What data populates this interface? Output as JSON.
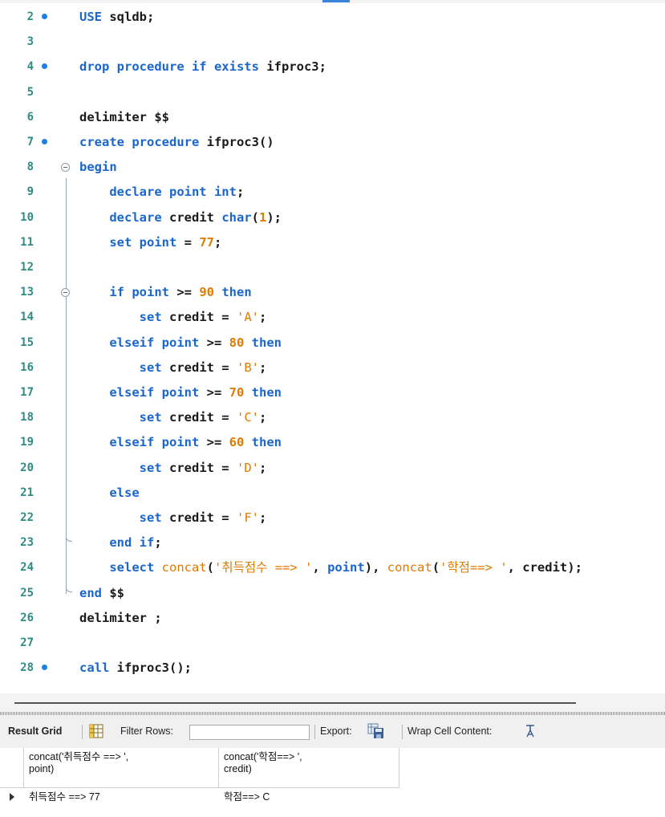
{
  "editor": {
    "lines": [
      {
        "n": "2",
        "bp": true,
        "tokens": [
          [
            "kw",
            "USE"
          ],
          [
            "plain",
            " sqldb;"
          ]
        ]
      },
      {
        "n": "3",
        "bp": false,
        "tokens": []
      },
      {
        "n": "4",
        "bp": true,
        "tokens": [
          [
            "kw",
            "drop procedure if exists"
          ],
          [
            "plain",
            " ifproc3;"
          ]
        ]
      },
      {
        "n": "5",
        "bp": false,
        "tokens": []
      },
      {
        "n": "6",
        "bp": false,
        "tokens": [
          [
            "plain",
            "delimiter $$"
          ]
        ]
      },
      {
        "n": "7",
        "bp": true,
        "tokens": [
          [
            "kw",
            "create procedure"
          ],
          [
            "plain",
            " ifproc3()"
          ]
        ]
      },
      {
        "n": "8",
        "bp": false,
        "tokens": [
          [
            "kw",
            "begin"
          ]
        ]
      },
      {
        "n": "9",
        "bp": false,
        "tokens": [
          [
            "plain",
            "    "
          ],
          [
            "kw",
            "declare point int"
          ],
          [
            "plain",
            ";"
          ]
        ]
      },
      {
        "n": "10",
        "bp": false,
        "tokens": [
          [
            "plain",
            "    "
          ],
          [
            "kw",
            "declare"
          ],
          [
            "plain",
            " credit "
          ],
          [
            "kw",
            "char"
          ],
          [
            "plain",
            "("
          ],
          [
            "num",
            "1"
          ],
          [
            "plain",
            ");"
          ]
        ]
      },
      {
        "n": "11",
        "bp": false,
        "tokens": [
          [
            "plain",
            "    "
          ],
          [
            "kw",
            "set point"
          ],
          [
            "plain",
            " = "
          ],
          [
            "num",
            "77"
          ],
          [
            "plain",
            ";"
          ]
        ]
      },
      {
        "n": "12",
        "bp": false,
        "tokens": []
      },
      {
        "n": "13",
        "bp": false,
        "tokens": [
          [
            "plain",
            "    "
          ],
          [
            "kw",
            "if point"
          ],
          [
            "plain",
            " >= "
          ],
          [
            "num",
            "90"
          ],
          [
            "plain",
            " "
          ],
          [
            "kw",
            "then"
          ]
        ]
      },
      {
        "n": "14",
        "bp": false,
        "tokens": [
          [
            "plain",
            "        "
          ],
          [
            "kw",
            "set"
          ],
          [
            "plain",
            " credit = "
          ],
          [
            "str",
            "'A'"
          ],
          [
            "plain",
            ";"
          ]
        ]
      },
      {
        "n": "15",
        "bp": false,
        "tokens": [
          [
            "plain",
            "    "
          ],
          [
            "kw",
            "elseif point"
          ],
          [
            "plain",
            " >= "
          ],
          [
            "num",
            "80"
          ],
          [
            "plain",
            " "
          ],
          [
            "kw",
            "then"
          ]
        ]
      },
      {
        "n": "16",
        "bp": false,
        "tokens": [
          [
            "plain",
            "        "
          ],
          [
            "kw",
            "set"
          ],
          [
            "plain",
            " credit = "
          ],
          [
            "str",
            "'B'"
          ],
          [
            "plain",
            ";"
          ]
        ]
      },
      {
        "n": "17",
        "bp": false,
        "tokens": [
          [
            "plain",
            "    "
          ],
          [
            "kw",
            "elseif point"
          ],
          [
            "plain",
            " >= "
          ],
          [
            "num",
            "70"
          ],
          [
            "plain",
            " "
          ],
          [
            "kw",
            "then"
          ]
        ]
      },
      {
        "n": "18",
        "bp": false,
        "tokens": [
          [
            "plain",
            "        "
          ],
          [
            "kw",
            "set"
          ],
          [
            "plain",
            " credit = "
          ],
          [
            "str",
            "'C'"
          ],
          [
            "plain",
            ";"
          ]
        ]
      },
      {
        "n": "19",
        "bp": false,
        "tokens": [
          [
            "plain",
            "    "
          ],
          [
            "kw",
            "elseif point"
          ],
          [
            "plain",
            " >= "
          ],
          [
            "num",
            "60"
          ],
          [
            "plain",
            " "
          ],
          [
            "kw",
            "then"
          ]
        ]
      },
      {
        "n": "20",
        "bp": false,
        "tokens": [
          [
            "plain",
            "        "
          ],
          [
            "kw",
            "set"
          ],
          [
            "plain",
            " credit = "
          ],
          [
            "str",
            "'D'"
          ],
          [
            "plain",
            ";"
          ]
        ]
      },
      {
        "n": "21",
        "bp": false,
        "tokens": [
          [
            "plain",
            "    "
          ],
          [
            "kw",
            "else"
          ]
        ]
      },
      {
        "n": "22",
        "bp": false,
        "tokens": [
          [
            "plain",
            "        "
          ],
          [
            "kw",
            "set"
          ],
          [
            "plain",
            " credit = "
          ],
          [
            "str",
            "'F'"
          ],
          [
            "plain",
            ";"
          ]
        ]
      },
      {
        "n": "23",
        "bp": false,
        "tokens": [
          [
            "plain",
            "    "
          ],
          [
            "kw",
            "end if"
          ],
          [
            "plain",
            ";"
          ]
        ]
      },
      {
        "n": "24",
        "bp": false,
        "tokens": [
          [
            "plain",
            "    "
          ],
          [
            "kw",
            "select"
          ],
          [
            "plain",
            " "
          ],
          [
            "fn",
            "concat"
          ],
          [
            "plain",
            "("
          ],
          [
            "str",
            "'취득점수 ==> '"
          ],
          [
            "plain",
            ", "
          ],
          [
            "kw",
            "point"
          ],
          [
            "plain",
            "), "
          ],
          [
            "fn",
            "concat"
          ],
          [
            "plain",
            "("
          ],
          [
            "str",
            "'학점==> '"
          ],
          [
            "plain",
            ", credit);"
          ]
        ]
      },
      {
        "n": "25",
        "bp": false,
        "tokens": [
          [
            "kw",
            "end"
          ],
          [
            "plain",
            " $$"
          ]
        ]
      },
      {
        "n": "26",
        "bp": false,
        "tokens": [
          [
            "plain",
            "delimiter ;"
          ]
        ]
      },
      {
        "n": "27",
        "bp": false,
        "tokens": []
      },
      {
        "n": "28",
        "bp": true,
        "tokens": [
          [
            "kw",
            "call"
          ],
          [
            "plain",
            " ifproc3();"
          ]
        ]
      }
    ]
  },
  "toolbar": {
    "result_grid": "Result Grid",
    "filter_rows": "Filter Rows:",
    "filter_value": "",
    "export": "Export:",
    "wrap_cell": "Wrap Cell Content:"
  },
  "result": {
    "columns": [
      "concat('취득점수 ==> ',\npoint)",
      "concat('학점==> ',\ncredit)"
    ],
    "rows": [
      [
        "취득점수 ==> 77",
        "학점==> C"
      ]
    ]
  },
  "colors": {
    "keyword": "#1a66cc",
    "number": "#e07a00",
    "line_number": "#2e8c84",
    "breakpoint": "#1e7fe0"
  }
}
